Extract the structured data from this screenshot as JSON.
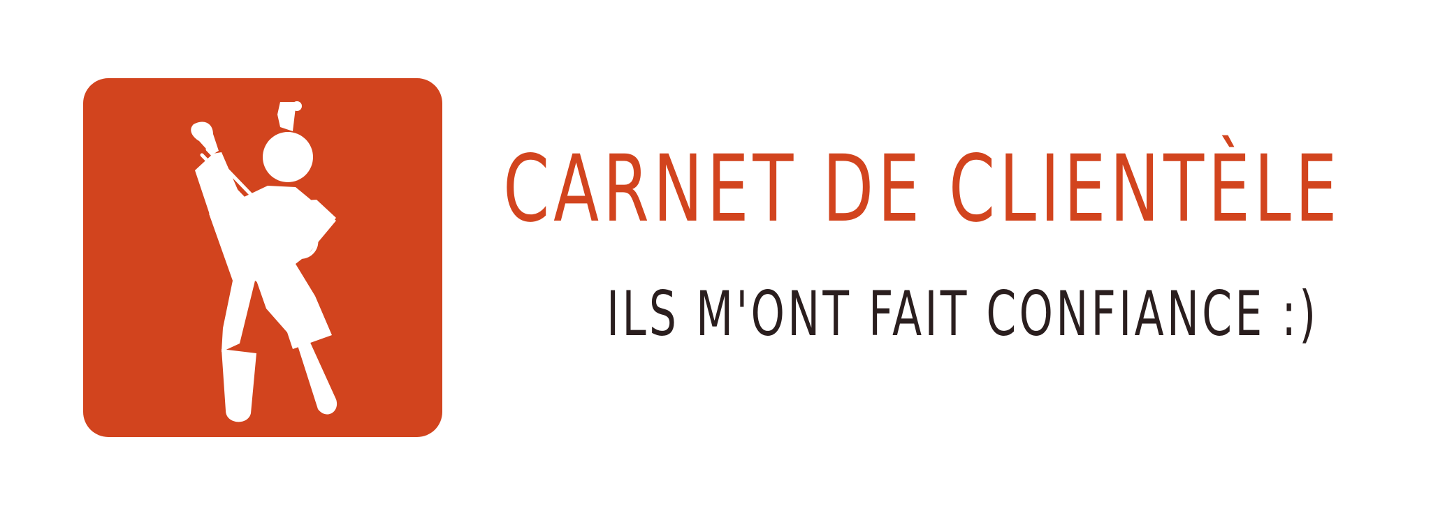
{
  "logo": {
    "icon": "badminton-player-icon",
    "background_color": "#D2441E",
    "foreground_color": "#FFFFFF"
  },
  "heading": {
    "title": "CARNET DE CLIENTÈLE",
    "subtitle": "ILS M'ONT FAIT CONFIANCE :)"
  },
  "colors": {
    "title": "#D2441E",
    "subtitle": "#2A1E1E"
  }
}
